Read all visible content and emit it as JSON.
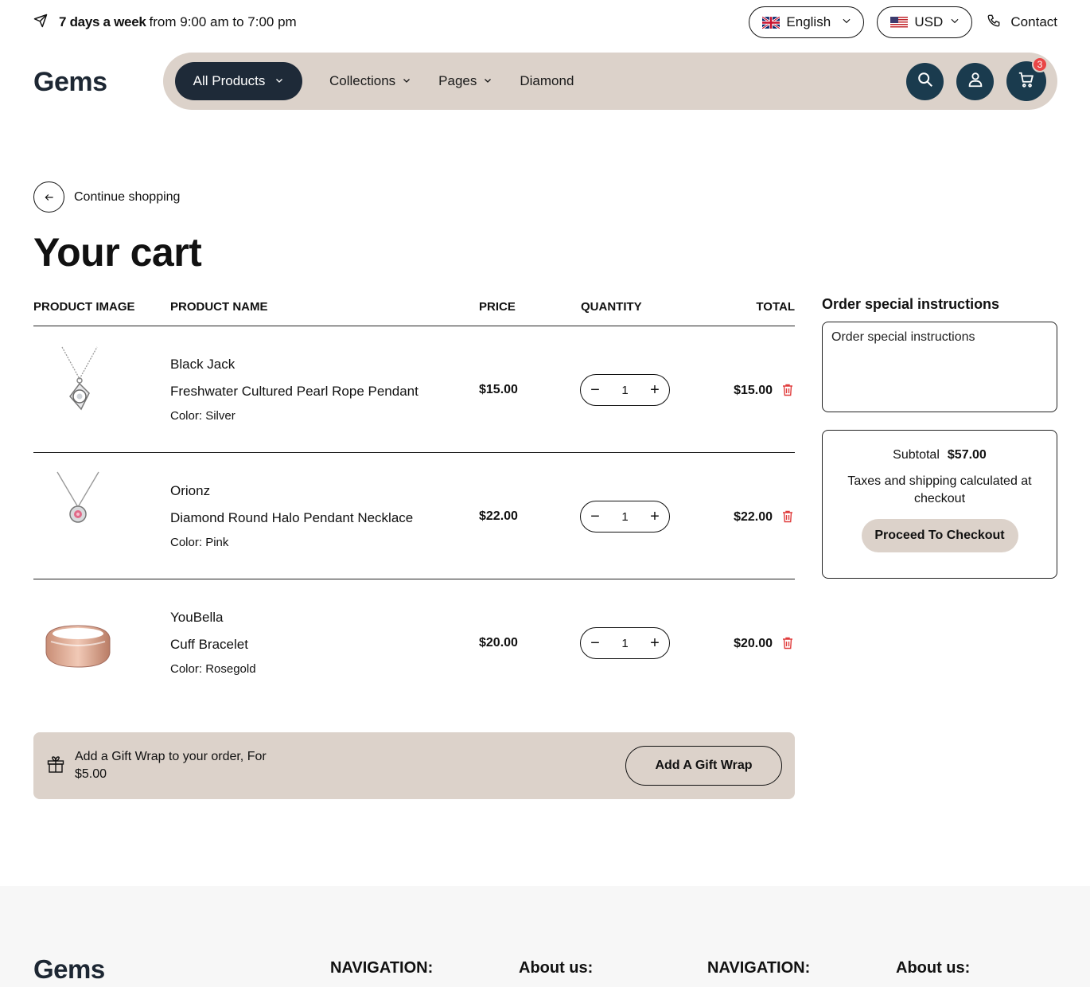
{
  "topbar": {
    "days": "7 days a week",
    "hours": "from 9:00 am to 7:00 pm",
    "language": "English",
    "currency": "USD",
    "contact": "Contact",
    "icons": [
      "send-icon",
      "uk-flag-icon",
      "us-flag-icon",
      "phone-icon"
    ]
  },
  "header": {
    "logo": "Gems",
    "nav": {
      "all_products": "All Products",
      "collections": "Collections",
      "pages": "Pages",
      "diamond": "Diamond"
    },
    "cart_count": "3",
    "accent_color": "#1a3b4e",
    "nav_bg_color": "#dcd2ca"
  },
  "cart": {
    "continue": "Continue shopping",
    "title": "Your cart",
    "columns": {
      "image": "PRODUCT IMAGE",
      "name": "PRODUCT NAME",
      "price": "PRICE",
      "quantity": "QUANTITY",
      "total": "TOTAL"
    },
    "items": [
      {
        "vendor": "Black Jack",
        "name": "Freshwater Cultured Pearl Rope Pendant",
        "color_label": "Color:",
        "color": "Silver",
        "price": "$15.00",
        "quantity": "1",
        "total": "$15.00"
      },
      {
        "vendor": "Orionz",
        "name": "Diamond Round Halo Pendant Necklace",
        "color_label": "Color:",
        "color": "Pink",
        "price": "$22.00",
        "quantity": "1",
        "total": "$22.00"
      },
      {
        "vendor": "YouBella",
        "name": "Cuff Bracelet",
        "color_label": "Color:",
        "color": "Rosegold",
        "price": "$20.00",
        "quantity": "1",
        "total": "$20.00"
      }
    ],
    "gift": {
      "text": "Add a Gift Wrap to your order, For $5.00",
      "button": "Add A Gift Wrap"
    }
  },
  "sidebar": {
    "instructions_title": "Order special instructions",
    "instructions_placeholder": "Order special instructions",
    "subtotal_label": "Subtotal",
    "subtotal_value": "$57.00",
    "tax_note": "Taxes and shipping calculated at checkout",
    "checkout": "Proceed To Checkout"
  },
  "footer": {
    "logo": "Gems",
    "headings": [
      "NAVIGATION:",
      "About us:",
      "NAVIGATION:",
      "About us:"
    ]
  }
}
